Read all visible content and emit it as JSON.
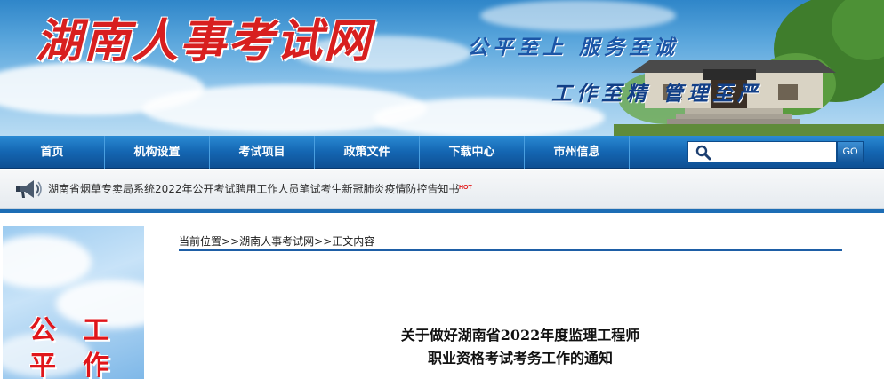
{
  "site": {
    "logo_text": "湖南人事考试网",
    "slogan_1": "公平至上  服务至诚",
    "slogan_2": "工作至精  管理至严"
  },
  "nav": {
    "items": [
      {
        "label": "首页"
      },
      {
        "label": "机构设置"
      },
      {
        "label": "考试项目"
      },
      {
        "label": "政策文件"
      },
      {
        "label": "下载中心"
      },
      {
        "label": "市州信息"
      }
    ]
  },
  "search": {
    "value": "",
    "button_label": "GO"
  },
  "notice": {
    "text": "湖南省烟草专卖局系统2022年公开考试聘用工作人员笔试考生新冠肺炎疫情防控告知书",
    "badge": "HOT"
  },
  "side_banner": {
    "chars": [
      "公",
      "平",
      "工",
      "作"
    ]
  },
  "breadcrumb": {
    "current_label": "当前位置",
    "sep_1": ">>",
    "home": "湖南人事考试网",
    "sep_2": ">>",
    "page": "正文内容"
  },
  "article": {
    "title_line_1": "关于做好湖南省2022年度监理工程师",
    "title_line_2": "职业资格考试考务工作的通知"
  },
  "colors": {
    "nav_blue": "#1466b2",
    "logo_red": "#d81f1f",
    "rule_blue": "#1e5ea6"
  }
}
